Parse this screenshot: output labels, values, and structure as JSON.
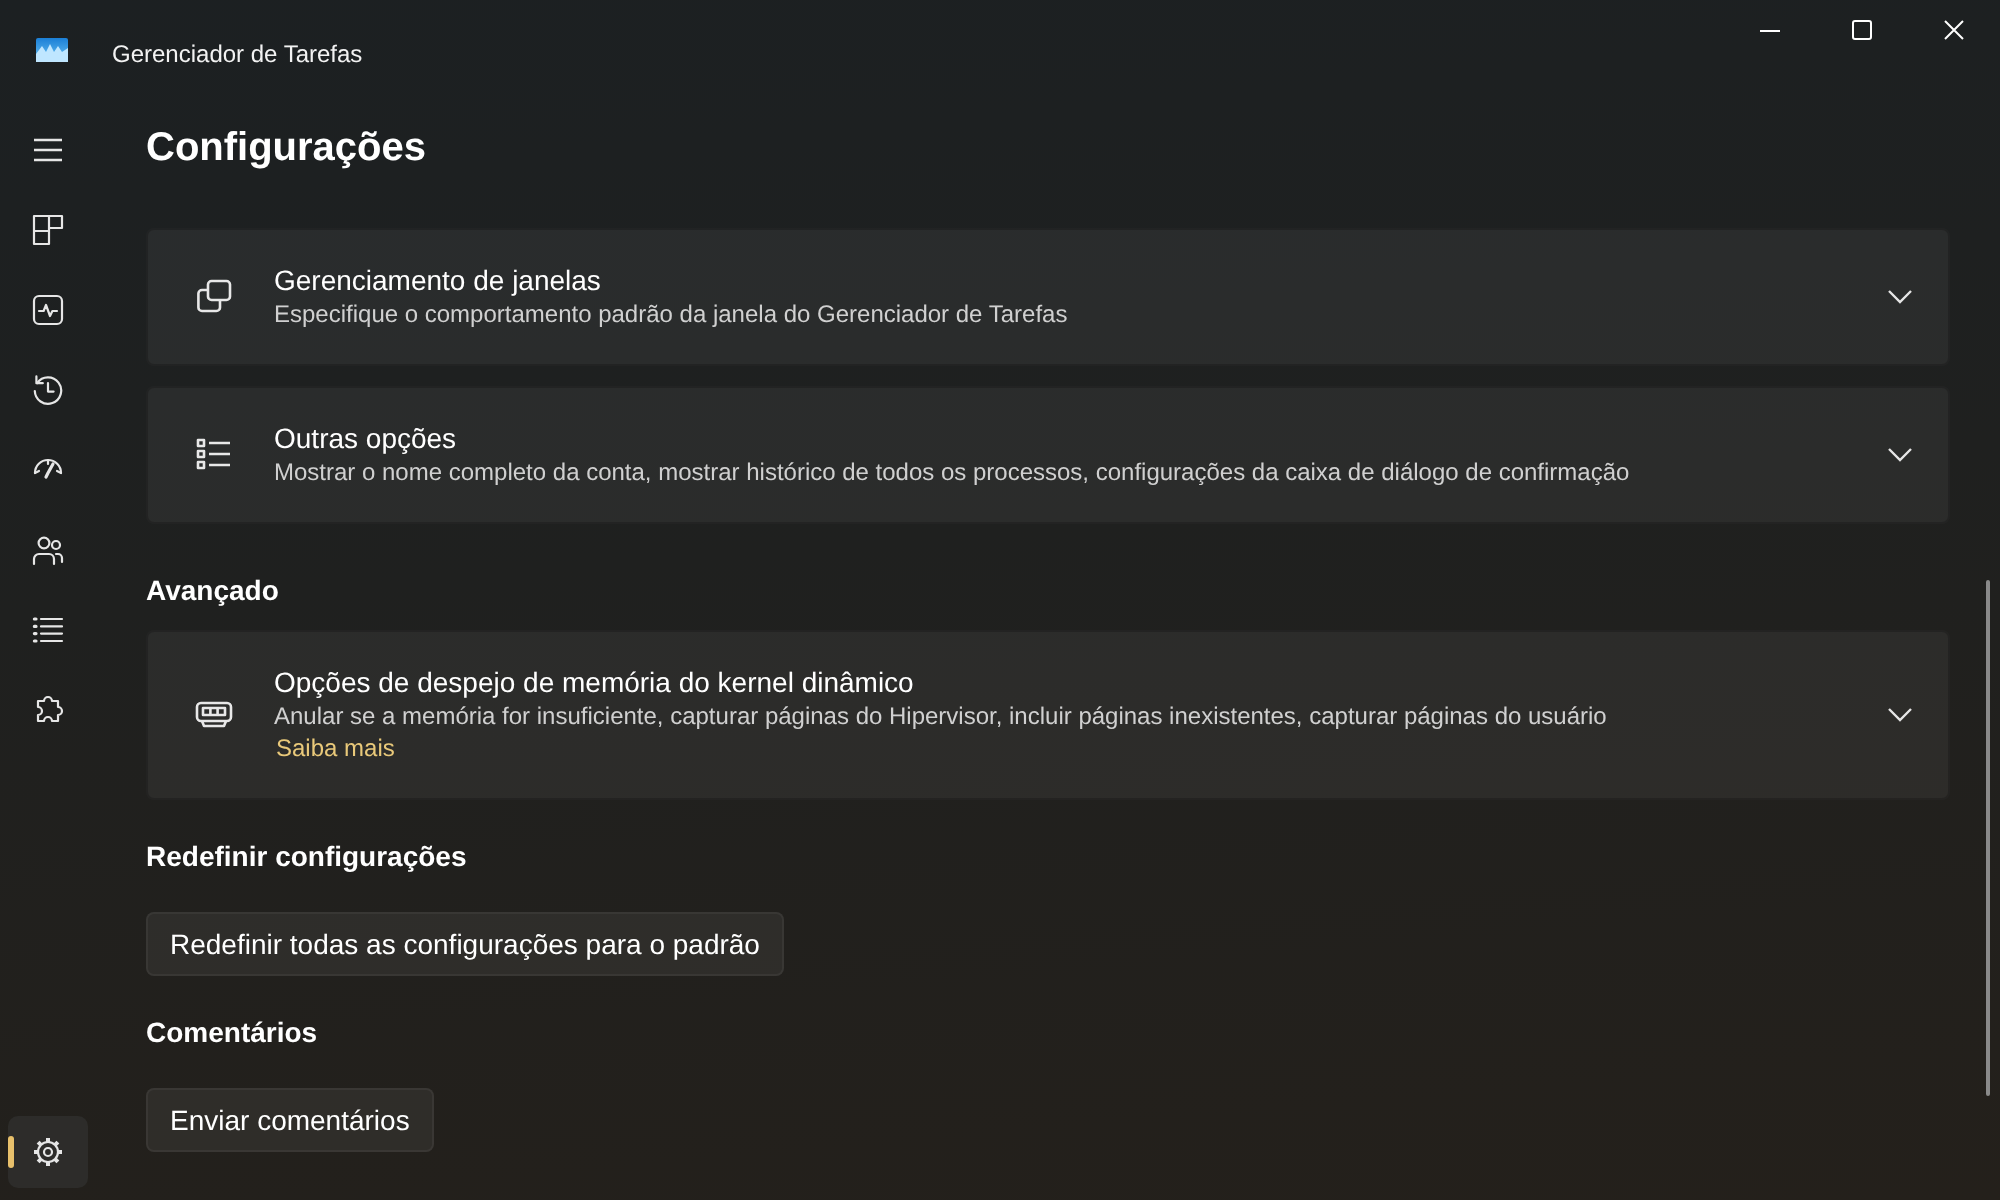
{
  "window": {
    "title": "Gerenciador de Tarefas"
  },
  "nav": {
    "items": [
      {
        "selected": false
      },
      {
        "selected": false
      },
      {
        "selected": false
      },
      {
        "selected": false
      },
      {
        "selected": false
      },
      {
        "selected": false
      },
      {
        "selected": false
      }
    ],
    "footer_items": [
      {
        "selected": true
      }
    ]
  },
  "page": {
    "title": "Configurações"
  },
  "sections": [
    {
      "kind": "cards",
      "cards": [
        {
          "title": "Gerenciamento de janelas",
          "description": "Especifique o comportamento padrão da janela do Gerenciador de Tarefas",
          "expanded": false
        },
        {
          "title": "Outras opções",
          "description": "Mostrar o nome completo da conta, mostrar histórico de todos os processos, configurações da caixa de diálogo de confirmação",
          "expanded": false
        }
      ]
    },
    {
      "kind": "cards",
      "heading": "Avançado",
      "cards": [
        {
          "title": "Opções de despejo de memória do kernel dinâmico",
          "description": "Anular se a memória for insuficiente, capturar páginas do Hipervisor, incluir páginas inexistentes, capturar páginas do usuário",
          "link": "Saiba mais",
          "expanded": false
        }
      ]
    },
    {
      "kind": "button",
      "heading": "Redefinir configurações",
      "button": "Redefinir todas as configurações para o padrão"
    },
    {
      "kind": "button",
      "heading": "Comentários",
      "button": "Enviar comentários"
    }
  ]
}
